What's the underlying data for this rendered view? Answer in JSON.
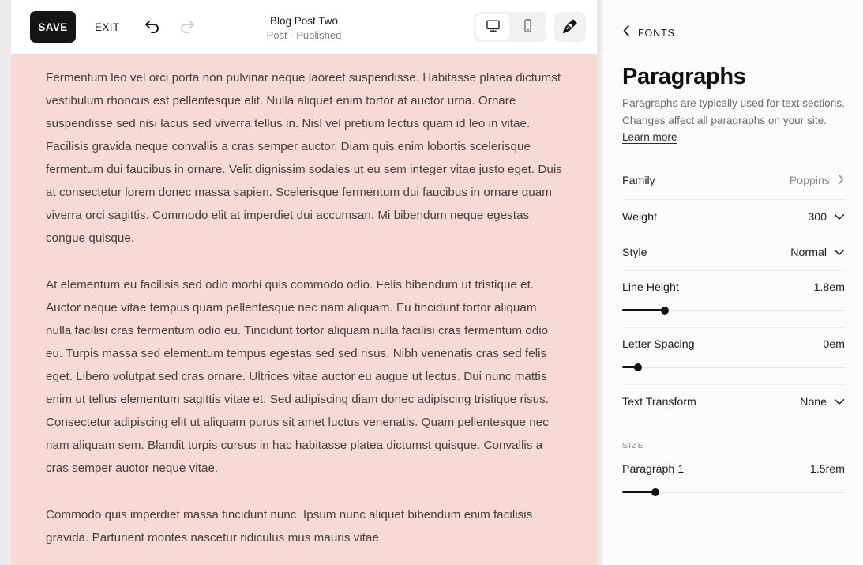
{
  "toolbar": {
    "save_label": "SAVE",
    "exit_label": "EXIT",
    "undo_icon": "undo-arrow-icon",
    "redo_icon": "redo-arrow-icon",
    "doc_title": "Blog Post Two",
    "doc_status": "Post · Published",
    "devices": [
      {
        "name": "desktop",
        "icon": "desktop-monitor-icon",
        "active": true
      },
      {
        "name": "mobile",
        "icon": "mobile-phone-icon",
        "active": false
      }
    ],
    "paint_icon": "paintbrush-icon"
  },
  "canvas": {
    "background_color": "#f7d9d5",
    "text_color": "#45403f",
    "paragraphs": [
      "Fermentum leo vel orci porta non pulvinar neque laoreet suspendisse. Habitasse platea dictumst vestibulum rhoncus est pellentesque elit. Nulla aliquet enim tortor at auctor urna. Ornare suspendisse sed nisi lacus sed viverra tellus in. Nisl vel pretium lectus quam id leo in vitae. Facilisis gravida neque convallis a cras semper auctor. Diam quis enim lobortis scelerisque fermentum dui faucibus in ornare. Velit dignissim sodales ut eu sem integer vitae justo eget. Duis at consectetur lorem donec massa sapien. Scelerisque fermentum dui faucibus in ornare quam viverra orci sagittis. Commodo elit at imperdiet dui accumsan. Mi bibendum neque egestas congue quisque.",
      "At elementum eu facilisis sed odio morbi quis commodo odio. Felis bibendum ut tristique et. Auctor neque vitae tempus quam pellentesque nec nam aliquam. Eu tincidunt tortor aliquam nulla facilisi cras fermentum odio eu. Tincidunt tortor aliquam nulla facilisi cras fermentum odio eu. Turpis massa sed elementum tempus egestas sed sed risus. Nibh venenatis cras sed felis eget. Libero volutpat sed cras ornare. Ultrices vitae auctor eu augue ut lectus. Dui nunc mattis enim ut tellus elementum sagittis vitae et. Sed adipiscing diam donec adipiscing tristique risus. Consectetur adipiscing elit ut aliquam purus sit amet luctus venenatis. Quam pellentesque nec nam aliquam sem. Blandit turpis cursus in hac habitasse platea dictumst quisque. Convallis a cras semper auctor neque vitae.",
      "Commodo quis imperdiet massa tincidunt nunc. Ipsum nunc aliquet bibendum enim facilisis gravida. Parturient montes nascetur ridiculus mus mauris vitae"
    ]
  },
  "panel": {
    "back_icon": "chevron-left-icon",
    "back_label": "FONTS",
    "title": "Paragraphs",
    "description": "Paragraphs are typically used for text sections. Changes affect all paragraphs on your site. ",
    "learn_more": "Learn more",
    "settings": [
      {
        "name": "family",
        "label": "Family",
        "value": "Poppins",
        "control": "chevron-right",
        "muted": true
      },
      {
        "name": "weight",
        "label": "Weight",
        "value": "300",
        "control": "chevron-down",
        "muted": false
      },
      {
        "name": "style",
        "label": "Style",
        "value": "Normal",
        "control": "chevron-down",
        "muted": false
      }
    ],
    "line_height": {
      "label": "Line Height",
      "value": "1.8em",
      "percent": 19
    },
    "letter_spacing": {
      "label": "Letter Spacing",
      "value": "0em",
      "percent": 7
    },
    "text_transform": {
      "label": "Text Transform",
      "value": "None",
      "control": "chevron-down"
    },
    "size_section": {
      "label": "SIZE",
      "item_label": "Paragraph 1",
      "item_value": "1.5rem",
      "percent": 15
    }
  },
  "colors": {
    "accent": "#151515",
    "canvas_pink": "#f7d9d5",
    "panel_bg": "#fbfbfb",
    "muted_text": "#8a8a8a"
  }
}
